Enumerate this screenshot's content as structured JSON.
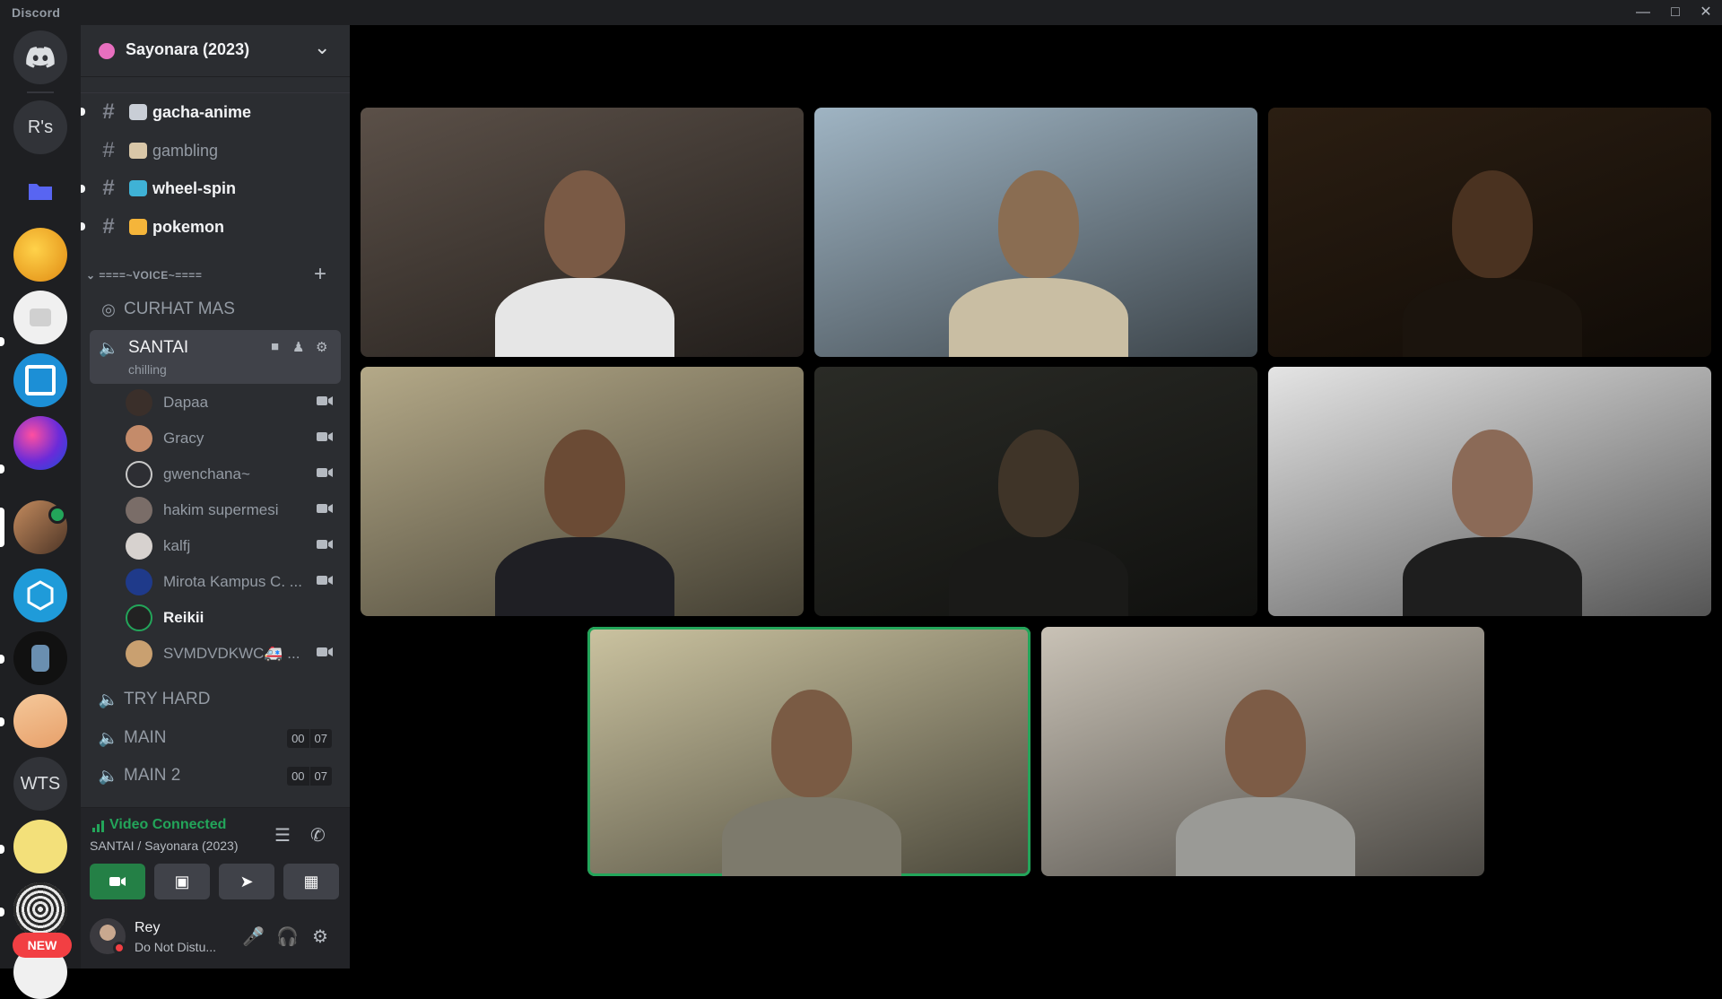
{
  "window": {
    "app_name": "Discord"
  },
  "rail": {
    "servers": [
      {
        "label": "R's"
      },
      {
        "label": "WTS"
      }
    ],
    "new_badge": "NEW"
  },
  "guild": {
    "name": "Sayonara (2023)"
  },
  "channels": [
    {
      "name": "gacha-anime",
      "emoji_color": "#c9ced6"
    },
    {
      "name": "gambling",
      "emoji_color": "#d9c7a8"
    },
    {
      "name": "wheel-spin",
      "emoji_color": "#3fb2d6"
    },
    {
      "name": "pokemon",
      "emoji_color": "#f5b53a"
    }
  ],
  "voice_category": "====~VOICE~====",
  "voice_channels": {
    "curhat_mas": "CURHAT MAS",
    "santai": {
      "name": "SANTAI",
      "status": "chilling"
    },
    "try_hard": "TRY HARD",
    "main": {
      "name": "MAIN",
      "badge_left": "00",
      "badge_right": "07"
    },
    "main2": {
      "name": "MAIN 2",
      "badge_left": "00",
      "badge_right": "07"
    }
  },
  "members": [
    {
      "name": "Dapaa",
      "avatar_color": "#3a2f2a"
    },
    {
      "name": "Gracy",
      "avatar_color": "#c48b6a"
    },
    {
      "name": "gwenchana~",
      "avatar_color": "#2d2e33"
    },
    {
      "name": "hakim supermesi",
      "avatar_color": "#7a6d68"
    },
    {
      "name": "kalfj",
      "avatar_color": "#d7d2cf"
    },
    {
      "name": "Mirota Kampus C. ...",
      "avatar_color": "#1f3a8a"
    },
    {
      "name": "Reikii",
      "avatar_color": "#2e7d4f"
    },
    {
      "name": "SVMDVDKWC🚑 ...",
      "avatar_color": "#c9a070"
    }
  ],
  "voice_panel": {
    "status": "Video Connected",
    "location": "SANTAI / Sayonara (2023)",
    "status_color": "#23a55a"
  },
  "user": {
    "name": "Rey",
    "status": "Do Not Distu..."
  },
  "tiles": [
    {
      "bg": "#5b5048",
      "skin": "#7a5a45",
      "shirt": "#e6e6e6"
    },
    {
      "bg": "#9fb4c3",
      "skin": "#8a6d52",
      "shirt": "#c9bea3"
    },
    {
      "bg": "#2b1e12",
      "skin": "#4a3220",
      "shirt": "#1b140d"
    },
    {
      "bg": "#b4a988",
      "skin": "#6b4b35",
      "shirt": "#1f1f24"
    },
    {
      "bg": "#2a2b26",
      "skin": "#3f3428",
      "shirt": "#1a1a18"
    },
    {
      "bg": "#e4e4e4",
      "skin": "#8b6a57",
      "shirt": "#1e1e1e"
    },
    {
      "bg": "#cbc3a0",
      "skin": "#7a5b44",
      "shirt": "#7d7a6c"
    },
    {
      "bg": "#c9c2b6",
      "skin": "#7d5c46",
      "shirt": "#9a9a96"
    }
  ]
}
